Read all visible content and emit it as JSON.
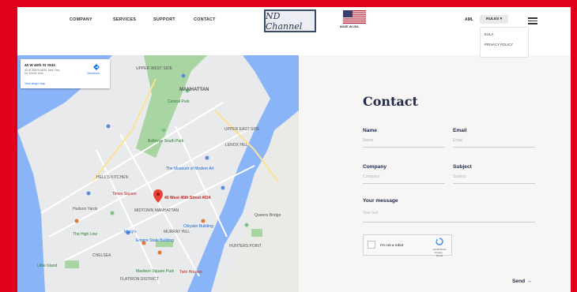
{
  "header": {
    "nav": [
      "COMPANY",
      "SERVICES",
      "SUPPORT",
      "CONTACT"
    ],
    "logo_text": "ND Channel",
    "made_label": "MADE IN USA",
    "lang_label": "AML",
    "rules_label": "RULES ▾",
    "rules_menu": [
      "EULA",
      "PRIVACY POLICY"
    ]
  },
  "map": {
    "info_title": "40 W 40th St #634",
    "info_address": "40 W 40th St #634, New York, NY 10018, USA",
    "directions_label": "Directions",
    "view_larger": "View larger map",
    "marker_label": "40 West 40th Street #634",
    "labels": [
      "MANHATTAN",
      "UPPER WEST SIDE",
      "UPPER EAST SIDE",
      "LENOX HILL",
      "HELL'S KITCHEN",
      "MIDTOWN MANHATTAN",
      "MURRAY HILL",
      "CHELSEA",
      "FLATIRON DISTRICT",
      "HUNTERS POINT",
      "Central Park",
      "Times Square",
      "The Museum of Modern Art",
      "Empire State Building",
      "Macy's",
      "Chrysler Building",
      "Queens Bridge",
      "Bellevue South Park",
      "Twin Houses",
      "Hudson Yards",
      "The High Line",
      "Madison Square Park",
      "Little Island"
    ]
  },
  "form": {
    "title": "Contact",
    "name_label": "Name",
    "name_placeholder": "Name",
    "email_label": "Email",
    "email_placeholder": "Email",
    "company_label": "Company",
    "company_placeholder": "Company",
    "subject_label": "Subject",
    "subject_placeholder": "Subject",
    "message_label": "Your message",
    "message_placeholder": "Your text",
    "captcha_label": "I'm not a robot",
    "captcha_brand": "reCAPTCHA",
    "captcha_terms": "Privacy - Terms",
    "send_label": "Send →"
  }
}
